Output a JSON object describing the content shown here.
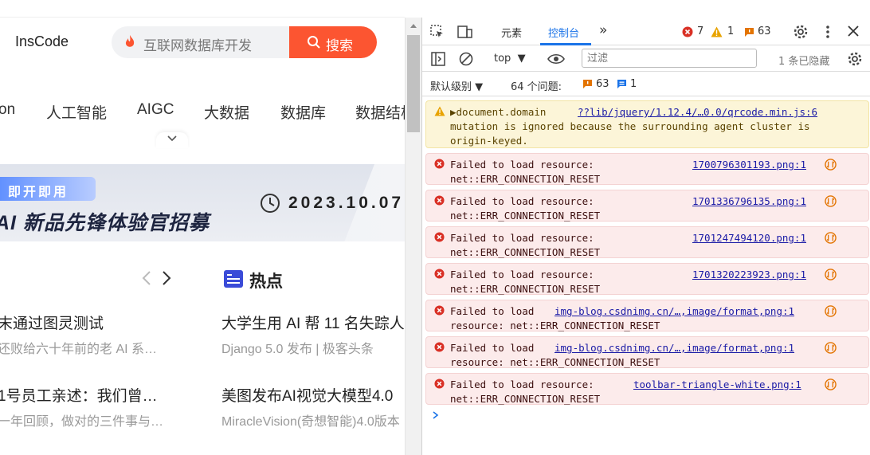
{
  "site": {
    "name": "InsCode",
    "search_placeholder": "互联网数据库开发",
    "search_button": "搜索",
    "nav": [
      "on",
      "人工智能",
      "AIGC",
      "大数据",
      "数据库",
      "数据结构"
    ],
    "banner": {
      "tag": "即开即用",
      "title": "AI 新品先锋体验官招募",
      "date": "2023.10.07"
    },
    "hot_title": "热点",
    "left_news": [
      {
        "title": "末通过图灵测试",
        "sub": "还败给六十年前的老 AI 系…"
      },
      {
        "title": "1号员工亲述：我们曾…",
        "sub": "一年回顾，做对的三件事与…"
      }
    ],
    "right_news": [
      {
        "title": "大学生用 AI 帮 11 名失踪人",
        "sub": "Django 5.0 发布 | 极客头条"
      },
      {
        "title": "美图发布AI视觉大模型4.0",
        "sub": "MiracleVision(奇想智能)4.0版本"
      }
    ]
  },
  "devtools": {
    "tabs": {
      "elements": "元素",
      "console": "控制台",
      "more": "»"
    },
    "counts": {
      "errors": "7",
      "warnings": "1",
      "issues": "63"
    },
    "context": "top",
    "filter_placeholder": "过滤",
    "hidden": "1 条已隐藏",
    "levels": "默认级别",
    "issues_label": "64 个问题:",
    "issue_counts": {
      "breaking": "63",
      "info": "1"
    },
    "colors": {
      "error": "#d93025",
      "warning": "#e8a300",
      "accent": "#1a73e8"
    },
    "messages": [
      {
        "level": "warning",
        "text": "▶document.domain\nmutation is ignored because the surrounding agent cluster is\norigin-keyed.",
        "link": "??lib/jquery/1.12.4/…0.0/qrcode.min.js:6"
      },
      {
        "level": "error",
        "text": "Failed to load resource:\nnet::ERR_CONNECTION_RESET",
        "link": "1700796301193.png:1"
      },
      {
        "level": "error",
        "text": "Failed to load resource:\nnet::ERR_CONNECTION_RESET",
        "link": "1701336796135.png:1"
      },
      {
        "level": "error",
        "text": "Failed to load resource:\nnet::ERR_CONNECTION_RESET",
        "link": "1701247494120.png:1"
      },
      {
        "level": "error",
        "text": "Failed to load resource:\nnet::ERR_CONNECTION_RESET",
        "link": "1701320223923.png:1"
      },
      {
        "level": "error",
        "text": "Failed to load\nresource: net::ERR_CONNECTION_RESET",
        "link": "img-blog.csdnimg.cn/…,image/format,png:1"
      },
      {
        "level": "error",
        "text": "Failed to load\nresource: net::ERR_CONNECTION_RESET",
        "link": "img-blog.csdnimg.cn/…,image/format,png:1"
      },
      {
        "level": "error",
        "text": "Failed to load resource:\nnet::ERR_CONNECTION_RESET",
        "link": "toolbar-triangle-white.png:1"
      }
    ]
  }
}
